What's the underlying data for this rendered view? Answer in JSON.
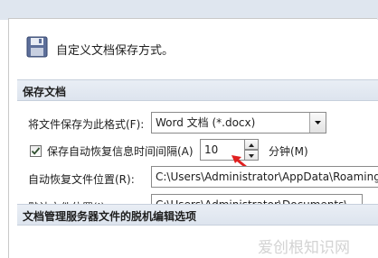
{
  "header": {
    "title": "自定义文档保存方式。",
    "icon": "save-disk-icon"
  },
  "sections": {
    "save_documents": "保存文档",
    "offline_editing": "文档管理服务器文件的脱机编辑选项"
  },
  "save_format": {
    "label": "将文件保存为此格式(F):",
    "value": "Word 文档 (*.docx)"
  },
  "autorecover": {
    "checkbox_label": "保存自动恢复信息时间间隔(A)",
    "checked": true,
    "value": "10",
    "unit_label": "分钟(M)"
  },
  "autorecover_location": {
    "label": "自动恢复文件位置(R):",
    "value": "C:\\Users\\Administrator\\AppData\\Roaming"
  },
  "default_location": {
    "label": "默认文件位置(I):",
    "value": "C:\\Users\\Administrator\\Documents\\"
  },
  "watermark": "爱创根知识网",
  "colors": {
    "annotation_arrow": "#e02020",
    "section_bg": "#dde4ee",
    "check": "#2f4f2f"
  }
}
